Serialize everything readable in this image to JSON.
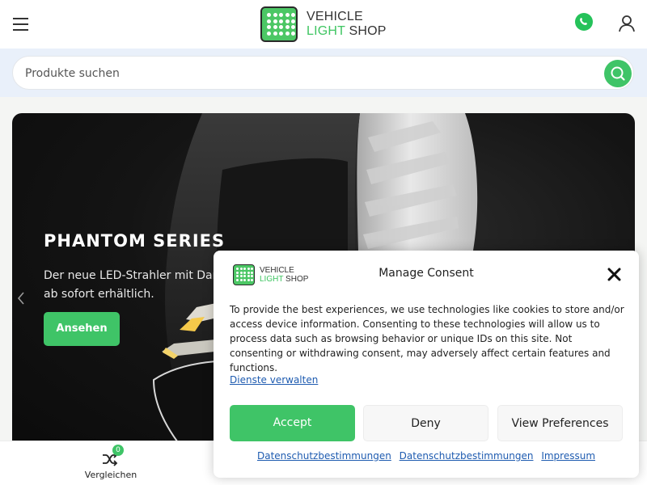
{
  "header": {
    "menu_icon": "hamburger-menu-icon",
    "logo": {
      "line1": "VEHICLE",
      "line2_green": "LIGHT",
      "line2_rest": " SHOP"
    },
    "whatsapp_icon": "whatsapp-icon",
    "account_icon": "user-icon"
  },
  "search": {
    "placeholder": "Produkte suchen",
    "button_icon": "search-icon"
  },
  "hero": {
    "title": "PHANTOM SERIES",
    "subtitle": "Der neue LED-Strahler mit Dar ist ab sofort erhältlich.",
    "button_label": "Ansehen",
    "prev_icon": "chevron-left-icon"
  },
  "bottom_nav": {
    "compare_label": "Vergleichen",
    "compare_count": "0",
    "compare_icon": "shuffle-icon"
  },
  "consent": {
    "title": "Manage Consent",
    "logo": {
      "line1": "VEHICLE",
      "line2_green": "LIGHT",
      "line2_rest": " SHOP"
    },
    "body": "To provide the best experiences, we use technologies like cookies to store and/or access device information. Consenting to these technologies will allow us to process data such as browsing behavior or unique IDs on this site. Not consenting or withdrawing consent, may adversely affect certain features and functions.",
    "manage_link": "Dienste verwalten",
    "accept_label": "Accept",
    "deny_label": "Deny",
    "preferences_label": "View Preferences",
    "links": [
      "Datenschutzbestimmungen",
      "Datenschutzbestimmungen",
      "Impressum"
    ],
    "close_icon": "close-icon"
  },
  "colors": {
    "accent_green": "#3fc467",
    "search_band": "#e9f0fa",
    "link_blue": "#1e5bb0"
  }
}
